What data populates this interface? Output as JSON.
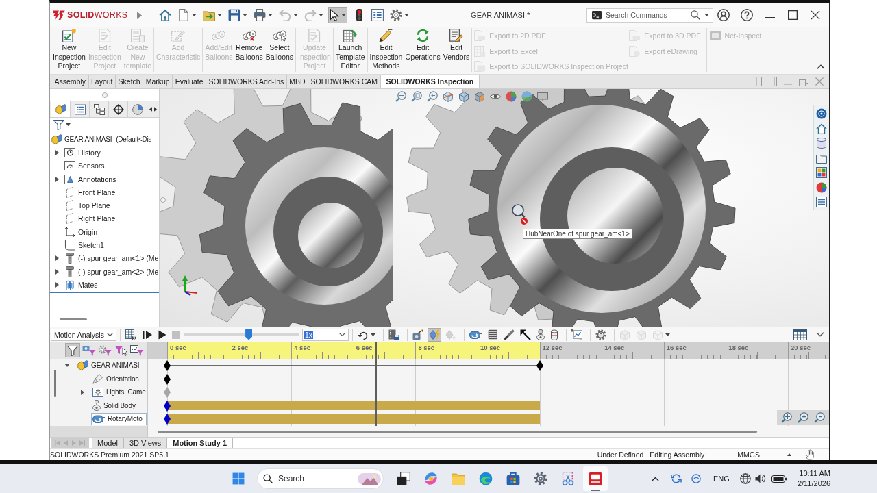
{
  "title_bar": {
    "app_name": "**SOLID**WORKS",
    "document_title": "GEAR ANIMASI *",
    "search": {
      "placeholder": "Search Commands"
    }
  },
  "quick_access": [
    {
      "kind": "home",
      "disabled": false,
      "pressed": false,
      "menu": false
    },
    {
      "kind": "new",
      "disabled": false,
      "pressed": false,
      "menu": true
    },
    {
      "kind": "open",
      "disabled": false,
      "pressed": false,
      "menu": true
    },
    {
      "kind": "save",
      "disabled": false,
      "pressed": false,
      "menu": true
    },
    {
      "kind": "print",
      "disabled": false,
      "pressed": false,
      "menu": true
    },
    {
      "kind": "undo",
      "disabled": true,
      "pressed": false,
      "menu": true
    },
    {
      "kind": "redo",
      "disabled": true,
      "pressed": false,
      "menu": true
    },
    {
      "kind": "select",
      "disabled": false,
      "pressed": true,
      "menu": true
    },
    {
      "kind": "rebuild",
      "disabled": false,
      "pressed": false,
      "menu": false
    },
    {
      "kind": "file-properties",
      "disabled": false,
      "pressed": false,
      "menu": false
    },
    {
      "kind": "options",
      "disabled": false,
      "pressed": false,
      "menu": true
    }
  ],
  "ribbon": {
    "groups": [
      [
        {
          "kind": "new-project",
          "label": "New\nInspection\nProject",
          "disabled": false
        },
        {
          "kind": "edit-project",
          "label": "Edit\nInspection\nProject",
          "disabled": true
        },
        {
          "kind": "template",
          "label": "Create\nNew\ntemplate",
          "disabled": true
        }
      ],
      [
        {
          "kind": "characteristic",
          "label": "Add\nCharacteristic",
          "disabled": true
        }
      ],
      [
        {
          "kind": "balloons",
          "label": "Add/Edit\nBalloons",
          "disabled": true
        },
        {
          "kind": "remove-balloons",
          "label": "Remove\nBalloons",
          "disabled": false
        },
        {
          "kind": "select-balloons",
          "label": "Select\nBalloons",
          "disabled": false
        }
      ],
      [
        {
          "kind": "update-project",
          "label": "Update\nInspection\nProject",
          "disabled": true
        }
      ],
      [
        {
          "kind": "template-editor",
          "label": "Launch\nTemplate\nEditor",
          "disabled": false
        }
      ],
      [
        {
          "kind": "methods",
          "label": "Edit\nInspection\nMethods",
          "disabled": false
        },
        {
          "kind": "operations",
          "label": "Edit\nOperations",
          "disabled": false
        },
        {
          "kind": "vendors",
          "label": "Edit\nVendors",
          "disabled": false
        }
      ]
    ],
    "export_buttons": [
      {
        "kind": "pdf",
        "label": "Export to 2D PDF",
        "disabled": true
      },
      {
        "kind": "excel",
        "label": "Export to Excel",
        "disabled": true
      },
      {
        "kind": "project",
        "label": "Export to SOLIDWORKS Inspection Project",
        "disabled": true
      },
      {
        "kind": "pdf",
        "label": "Export to 3D PDF",
        "disabled": true
      },
      {
        "kind": "edrawing",
        "label": "Export eDrawing",
        "disabled": true
      }
    ],
    "net_inspect": {
      "label": "Net-Inspect",
      "disabled": true
    }
  },
  "command_tabs": [
    {
      "label": "Assembly",
      "selected": false
    },
    {
      "label": "Layout",
      "selected": false
    },
    {
      "label": "Sketch",
      "selected": false
    },
    {
      "label": "Markup",
      "selected": false
    },
    {
      "label": "Evaluate",
      "selected": false
    },
    {
      "label": "SOLIDWORKS Add-Ins",
      "selected": false
    },
    {
      "label": "MBD",
      "selected": false
    },
    {
      "label": "SOLIDWORKS CAM",
      "selected": false
    },
    {
      "label": "SOLIDWORKS Inspection",
      "selected": true
    }
  ],
  "feature_manager": {
    "panel_tabs": [
      {
        "kind": "feature-tree",
        "selected": true
      },
      {
        "kind": "property-manager",
        "selected": false
      },
      {
        "kind": "configuration-manager",
        "selected": false
      },
      {
        "kind": "dimxpert",
        "selected": false
      },
      {
        "kind": "display-manager",
        "selected": false
      }
    ],
    "root": {
      "label": "GEAR ANIMASI",
      "configuration": "(Default<Dis"
    },
    "items": [
      {
        "kind": "history",
        "label": "History",
        "expanded": false
      },
      {
        "kind": "sensors",
        "label": "Sensors"
      },
      {
        "kind": "annotations",
        "label": "Annotations",
        "expanded": false
      },
      {
        "kind": "plane",
        "label": "Front Plane"
      },
      {
        "kind": "plane",
        "label": "Top Plane"
      },
      {
        "kind": "plane",
        "label": "Right Plane"
      },
      {
        "kind": "origin",
        "label": "Origin"
      },
      {
        "kind": "sketch",
        "label": "Sketch1"
      },
      {
        "kind": "part",
        "label": "(-) spur gear_am<1> (Me",
        "expanded": false
      },
      {
        "kind": "part",
        "label": "(-) spur gear_am<2> (Me",
        "expanded": false
      },
      {
        "kind": "mates",
        "label": "Mates",
        "expanded": false
      }
    ]
  },
  "viewport": {
    "tooltip": "HubNearOne of spur gear_am<1>"
  },
  "motion_study": {
    "study_type": "Motion Analysis",
    "playback_buttons": [
      {
        "kind": "calculate",
        "disabled": false,
        "pressed": false,
        "menu": false
      },
      {
        "kind": "play-from-start",
        "disabled": false,
        "pressed": false,
        "menu": false
      },
      {
        "kind": "play",
        "disabled": false,
        "pressed": false,
        "menu": false
      },
      {
        "kind": "stop",
        "disabled": true,
        "pressed": false,
        "menu": false
      }
    ],
    "playback": {
      "level": 0.56
    },
    "speed": {
      "value": "1x",
      "text_selected": true
    },
    "tool_groups": [
      [
        {
          "kind": "loop",
          "disabled": false,
          "pressed": false,
          "menu": true
        }
      ],
      [
        {
          "kind": "save-animation",
          "disabled": false,
          "pressed": false,
          "menu": false
        }
      ],
      [
        {
          "kind": "wizard",
          "disabled": false,
          "pressed": false,
          "menu": false
        },
        {
          "kind": "autokey",
          "disabled": false,
          "pressed": true,
          "menu": false
        },
        {
          "kind": "add-key",
          "disabled": true,
          "pressed": false,
          "menu": false
        }
      ],
      [
        {
          "kind": "motor",
          "disabled": false,
          "pressed": false,
          "menu": false
        },
        {
          "kind": "spring",
          "disabled": false,
          "pressed": false,
          "menu": false
        },
        {
          "kind": "damper",
          "disabled": false,
          "pressed": false,
          "menu": false
        },
        {
          "kind": "force",
          "disabled": false,
          "pressed": false,
          "menu": false
        },
        {
          "kind": "contact",
          "disabled": false,
          "pressed": false,
          "menu": false
        },
        {
          "kind": "gravity",
          "disabled": false,
          "pressed": false,
          "menu": false
        }
      ],
      [
        {
          "kind": "results",
          "disabled": false,
          "pressed": false,
          "menu": false
        }
      ],
      [
        {
          "kind": "properties",
          "disabled": false,
          "pressed": false,
          "menu": false
        }
      ],
      [
        {
          "kind": "sim-a",
          "disabled": true,
          "pressed": false,
          "menu": false
        },
        {
          "kind": "sim-b",
          "disabled": true,
          "pressed": false,
          "menu": false
        },
        {
          "kind": "sim-c",
          "disabled": true,
          "pressed": false,
          "menu": true
        }
      ]
    ],
    "filters": [
      {
        "kind": "filter-all",
        "pressed": true
      },
      {
        "kind": "filter-animated",
        "pressed": false
      },
      {
        "kind": "filter-driving",
        "pressed": false
      },
      {
        "kind": "filter-selected",
        "pressed": false
      },
      {
        "kind": "filter-results",
        "pressed": false
      }
    ],
    "tree": {
      "label": "GEAR ANIMASI",
      "kind": "assembly",
      "expanded": true,
      "selected": false,
      "color": "#000000",
      "bar": false,
      "line": true,
      "end_key": true,
      "children": [
        {
          "label": "Orientation",
          "kind": "camera",
          "selected": false,
          "color": "#000000",
          "bar": false,
          "line": false,
          "end_key": false
        },
        {
          "label": "Lights, Came",
          "kind": "lights",
          "expanded": false,
          "selected": false,
          "color": "#a6a6a6",
          "bar": false,
          "line": false,
          "end_key": false
        },
        {
          "label": "Solid Body",
          "kind": "body",
          "selected": false,
          "color": "#0000c8",
          "bar": true,
          "line": false,
          "end_key": false
        },
        {
          "label": "RotaryMoto",
          "kind": "motor",
          "selected": true,
          "color": "#0000c8",
          "bar": true,
          "line": false,
          "end_key": false
        }
      ]
    },
    "ruler": [
      {
        "label": "0 sec",
        "in_range": true
      },
      {
        "label": "2 sec",
        "in_range": true
      },
      {
        "label": "4 sec",
        "in_range": true
      },
      {
        "label": "6 sec",
        "in_range": true
      },
      {
        "label": "8 sec",
        "in_range": true
      },
      {
        "label": "10 sec",
        "in_range": true
      },
      {
        "label": "12 sec",
        "in_range": false
      },
      {
        "label": "14 sec",
        "in_range": false
      },
      {
        "label": "16 sec",
        "in_range": false
      },
      {
        "label": "18 sec",
        "in_range": false
      },
      {
        "label": "20 sec",
        "in_range": false
      }
    ]
  },
  "bottom_tabs": {
    "nav_buttons": [
      {
        "kind": "first",
        "disabled": true
      },
      {
        "kind": "previous",
        "disabled": true
      },
      {
        "kind": "next",
        "disabled": true
      },
      {
        "kind": "last",
        "disabled": true
      }
    ],
    "tabs": [
      {
        "label": "Model",
        "selected": false
      },
      {
        "label": "3D Views",
        "selected": false
      },
      {
        "label": "Motion Study 1",
        "selected": true
      }
    ]
  },
  "status_bar": {
    "product": "SOLIDWORKS Premium 2021 SP5.1",
    "sketch_state": "Under Defined",
    "mode": "Editing Assembly",
    "units": "MMGS"
  },
  "taskbar": {
    "search": {
      "placeholder": "Search"
    },
    "apps": [
      {
        "kind": "task-view",
        "selected": false
      },
      {
        "kind": "assistant",
        "selected": false
      },
      {
        "kind": "files",
        "selected": false
      },
      {
        "kind": "browser",
        "selected": false
      },
      {
        "kind": "store",
        "selected": false
      },
      {
        "kind": "settings",
        "selected": false
      },
      {
        "kind": "snipping",
        "selected": false
      },
      {
        "kind": "cad",
        "selected": true
      }
    ],
    "language": "ENG",
    "time": "10:11 AM",
    "date": "2/11/2026"
  }
}
